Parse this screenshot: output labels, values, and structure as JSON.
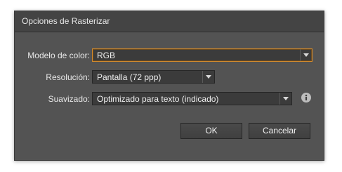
{
  "dialog": {
    "title": "Opciones de Rasterizar",
    "color_model": {
      "label": "Modelo de color:",
      "value": "RGB"
    },
    "resolution": {
      "label": "Resolución:",
      "value": "Pantalla (72 ppp)"
    },
    "antialiasing": {
      "label": "Suavizado:",
      "value": "Optimizado para texto (indicado)",
      "info_icon": "info-icon"
    },
    "buttons": {
      "ok": "OK",
      "cancel": "Cancelar"
    }
  },
  "colors": {
    "dialog_bg": "#535353",
    "titlebar_bg": "#444444",
    "field_bg": "#3b3b3b",
    "focus_border": "#d48a2a",
    "text": "#e8e8e8"
  }
}
